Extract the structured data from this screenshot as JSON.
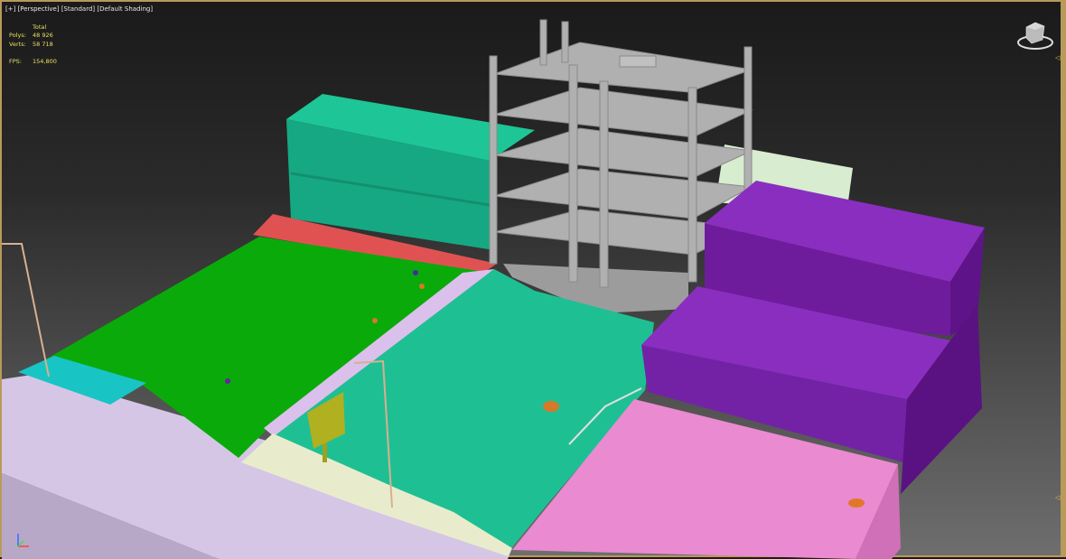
{
  "viewport": {
    "menu_plus": "[+]",
    "view_label": "[Perspective]",
    "shading_mode_label": "[Standard]",
    "style_label": "[Default Shading]"
  },
  "stats": {
    "header": "Total",
    "polys_label": "Polys:",
    "polys_value": "48 926",
    "verts_label": "Verts:",
    "verts_value": "58 718",
    "fps_label": "FPS:",
    "fps_value": "154,800"
  },
  "colors": {
    "border": "#b89a5a",
    "teal": "#1fbf94",
    "green": "#0aaa0a",
    "purple": "#7a22b0",
    "pink": "#ea8ad0",
    "lavender": "#d6c6e6",
    "red": "#e05050",
    "gray": "#a6a6a6"
  }
}
